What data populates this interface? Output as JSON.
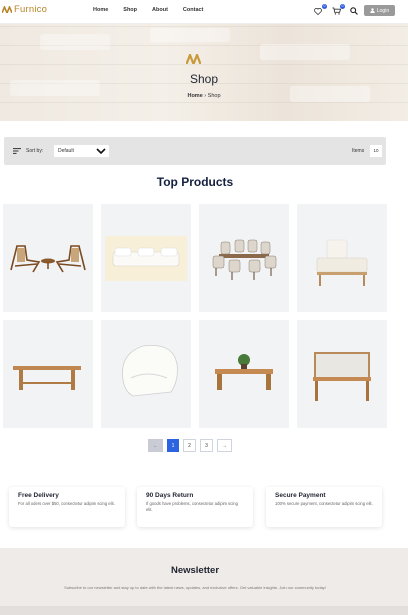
{
  "brand": {
    "name": "Furnico",
    "accent": "#b7852a"
  },
  "nav": [
    {
      "label": "Home"
    },
    {
      "label": "Shop"
    },
    {
      "label": "About"
    },
    {
      "label": "Contact"
    }
  ],
  "header": {
    "wishlist_count": "0",
    "cart_count": "0",
    "login_label": "Login",
    "icons": [
      "heart-icon",
      "cart-icon",
      "search-icon",
      "user-icon"
    ]
  },
  "hero": {
    "title": "Shop",
    "breadcrumb": {
      "home": "Home",
      "separator": "›",
      "current": "Shop"
    }
  },
  "toolbar": {
    "sort_label": "Sort by:",
    "sort_value": "Default",
    "items_label": "Items",
    "items_value": "10"
  },
  "section_title": "Top Products",
  "products": [
    {
      "name": "lounge-chairs-set"
    },
    {
      "name": "white-sofa"
    },
    {
      "name": "dining-set"
    },
    {
      "name": "daybed"
    },
    {
      "name": "wooden-table"
    },
    {
      "name": "armchair"
    },
    {
      "name": "coffee-table"
    },
    {
      "name": "console-mirror"
    }
  ],
  "pagination": {
    "prev": "←",
    "pages": [
      "1",
      "2",
      "3"
    ],
    "next": "→",
    "active": "1"
  },
  "features": [
    {
      "title": "Free Delivery",
      "desc": "For all oders over $50, consectetur adipim scing elit."
    },
    {
      "title": "90 Days Return",
      "desc": "If goods have problems, consectetur adipim scing elit."
    },
    {
      "title": "Secure Payment",
      "desc": "100% secure payment, consectetur adipim scing elit."
    }
  ],
  "newsletter": {
    "title": "Newsletter",
    "desc": "Subscribe to our newsletter and stay up to date with the latest news, updates, and exclusive offers. Get valuable insights. Join our community today!"
  }
}
